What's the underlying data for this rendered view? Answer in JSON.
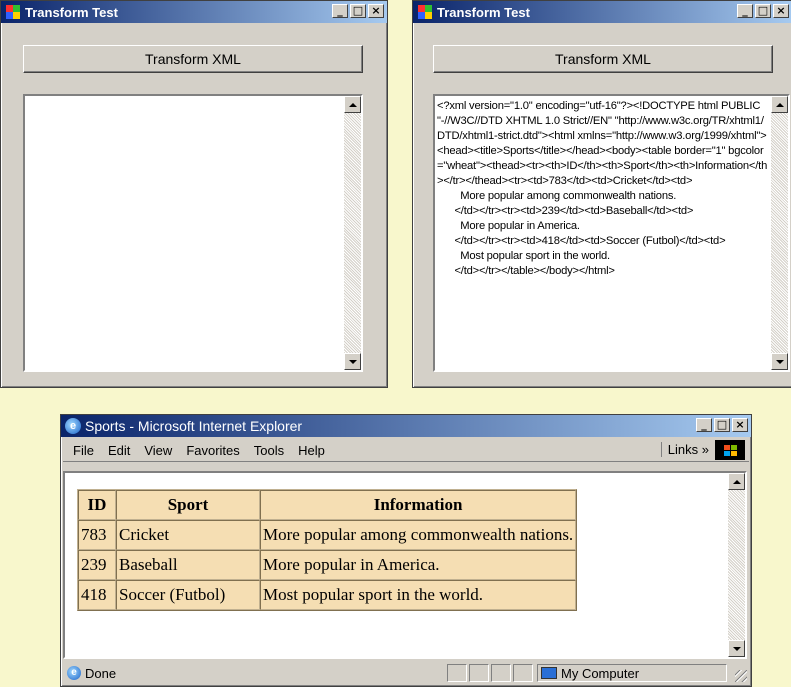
{
  "left_window": {
    "title": "Transform Test",
    "button_label": "Transform XML",
    "textbox_value": ""
  },
  "right_window": {
    "title": "Transform Test",
    "button_label": "Transform XML",
    "textbox_value": "<?xml version=\"1.0\" encoding=\"utf-16\"?><!DOCTYPE html PUBLIC \"-//W3C//DTD XHTML 1.0 Strict//EN\" \"http://www.w3c.org/TR/xhtml1/DTD/xhtml1-strict.dtd\"><html xmlns=\"http://www.w3.org/1999/xhtml\"><head><title>Sports</title></head><body><table border=\"1\" bgcolor=\"wheat\"><thead><tr><th>ID</th><th>Sport</th><th>Information</th></tr></thead><tr><td>783</td><td>Cricket</td><td>\n        More popular among commonwealth nations.\n      </td></tr><tr><td>239</td><td>Baseball</td><td>\n        More popular in America.\n      </td></tr><tr><td>418</td><td>Soccer (Futbol)</td><td>\n        Most popular sport in the world.\n      </td></tr></table></body></html>"
  },
  "browser": {
    "title": "Sports - Microsoft Internet Explorer",
    "menu": [
      "File",
      "Edit",
      "View",
      "Favorites",
      "Tools",
      "Help"
    ],
    "links_label": "Links",
    "links_chevron": "»",
    "status_text": "Done",
    "zone_text": "My Computer",
    "table": {
      "headers": [
        "ID",
        "Sport",
        "Information"
      ],
      "rows": [
        [
          "783",
          "Cricket",
          "More popular among commonwealth nations."
        ],
        [
          "239",
          "Baseball",
          "More popular in America."
        ],
        [
          "418",
          "Soccer (Futbol)",
          "Most popular sport in the world."
        ]
      ],
      "bgcolor": "#f5deb3"
    }
  },
  "colors": {
    "background": "#f8f7cc",
    "titlebar_start": "#0a246a",
    "titlebar_end": "#a6caf0",
    "window_face": "#d4d0c8"
  },
  "icons": {
    "app": "windows-form-icon",
    "ie": "ie-icon",
    "minimize": "minimize-icon",
    "maximize": "maximize-icon",
    "close": "close-icon"
  }
}
